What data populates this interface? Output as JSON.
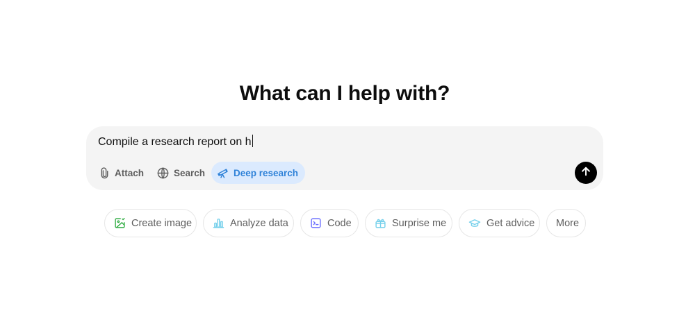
{
  "heading": "What can I help with?",
  "composer": {
    "input_value": "Compile a research report on h",
    "tools": {
      "attach": "Attach",
      "search": "Search",
      "deep_research": "Deep research"
    },
    "send_icon": "arrow-up-icon"
  },
  "suggestions": [
    {
      "label": "Create image",
      "icon": "image-icon",
      "color": "#35ae47"
    },
    {
      "label": "Analyze data",
      "icon": "bar-chart-icon",
      "color": "#76d0eb"
    },
    {
      "label": "Code",
      "icon": "terminal-icon",
      "color": "#6c71ff"
    },
    {
      "label": "Surprise me",
      "icon": "gift-icon",
      "color": "#76d0eb"
    },
    {
      "label": "Get advice",
      "icon": "graduation-cap-icon",
      "color": "#76d0eb"
    },
    {
      "label": "More",
      "icon": "",
      "color": ""
    }
  ],
  "colors": {
    "deep_research_bg": "#dbeafe",
    "deep_research_text": "#2f82d8",
    "composer_bg": "#f4f4f4"
  }
}
